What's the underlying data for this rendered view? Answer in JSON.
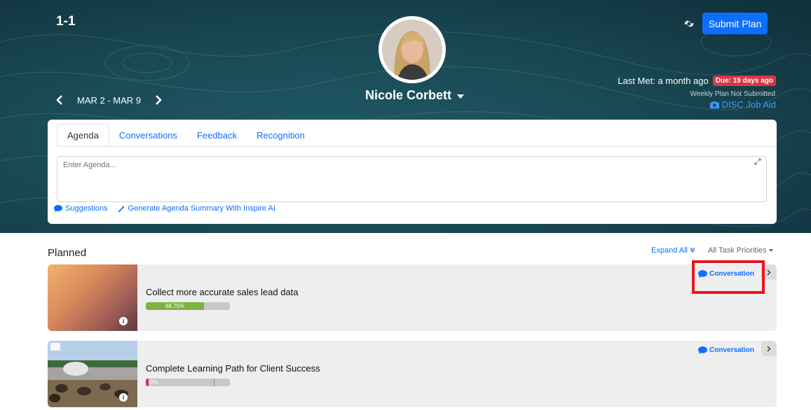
{
  "header": {
    "title": "1-1",
    "week_range": "MAR 2 - MAR 9",
    "person_name": "Nicole Corbett",
    "submit_label": "Submit Plan",
    "last_met": "Last Met: a month ago",
    "due_badge": "Due: 19 days ago",
    "weekly_status": "Weekly Plan Not Submitted",
    "disc_link": "DISC Job Aid",
    "accent_color": "#0d6efd",
    "due_color": "#dc3545"
  },
  "agenda": {
    "tabs": [
      "Agenda",
      "Conversations",
      "Feedback",
      "Recognition"
    ],
    "active_tab": "Agenda",
    "placeholder": "Enter Agenda...",
    "suggestions_label": "Suggestions",
    "summary_label": "Generate Agenda Summary With Inspire AI"
  },
  "planned": {
    "title": "Planned",
    "expand_all": "Expand All",
    "priorities": "All Task Priorities",
    "tasks": [
      {
        "title": "Collect more accurate sales lead data",
        "progress_label": "68.75%",
        "progress": 0.6875,
        "progress_color": "#7cb342",
        "conversation": "Conversation"
      },
      {
        "title": "Complete Learning Path for Client Success",
        "progress_label": "0%",
        "progress": 0,
        "progress_color": "#dc3545",
        "conversation": "Conversation"
      }
    ]
  }
}
